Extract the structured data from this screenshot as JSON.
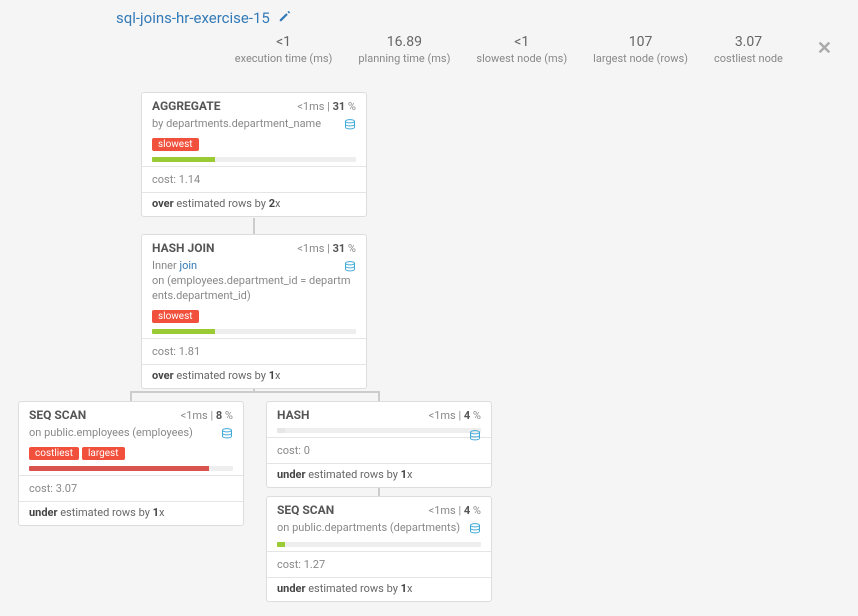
{
  "title": "sql-joins-hr-exercise-15",
  "stats": {
    "exec_val": "<1",
    "exec_lbl": "execution time (ms)",
    "plan_val": "16.89",
    "plan_lbl": "planning time (ms)",
    "slow_val": "<1",
    "slow_lbl": "slowest node (ms)",
    "large_val": "107",
    "large_lbl": "largest node (rows)",
    "cost_val": "3.07",
    "cost_lbl": "costliest node"
  },
  "nodes": {
    "agg": {
      "type": "AGGREGATE",
      "time": "<1ms",
      "pct": "31",
      "desc_pre": "by ",
      "desc": "departments.department_name",
      "tags": [
        "slowest"
      ],
      "bar_w": "31%",
      "bar_color": "#9acb34",
      "cost_lbl": "cost: ",
      "cost": "1.14",
      "est_pre": "over",
      "est_mid": " estimated rows by ",
      "est_x": "2",
      "est_suf": "x"
    },
    "hash_join": {
      "type": "HASH JOIN",
      "time": "<1ms",
      "pct": "31",
      "desc_pre": "Inner ",
      "desc_link": "join",
      "desc2_pre": "on ",
      "desc2": "(employees.department_id = departments.department_id)",
      "tags": [
        "slowest"
      ],
      "bar_w": "31%",
      "bar_color": "#9acb34",
      "cost_lbl": "cost: ",
      "cost": "1.81",
      "est_pre": "over",
      "est_mid": " estimated rows by ",
      "est_x": "1",
      "est_suf": "x"
    },
    "seq_emp": {
      "type": "SEQ SCAN",
      "time": "<1ms",
      "pct": "8",
      "desc_pre": "on ",
      "desc": "public.employees (employees)",
      "tags": [
        "costliest",
        "largest"
      ],
      "bar_w": "88%",
      "bar_color": "#d9534f",
      "cost_lbl": "cost: ",
      "cost": "3.07",
      "est_pre": "under",
      "est_mid": " estimated rows by ",
      "est_x": "1",
      "est_suf": "x"
    },
    "hash": {
      "type": "HASH",
      "time": "<1ms",
      "pct": "4",
      "bar_w": "4%",
      "bar_color": "#e6e6e6",
      "cost_lbl": "cost: ",
      "cost": "0",
      "est_pre": "under",
      "est_mid": " estimated rows by ",
      "est_x": "1",
      "est_suf": "x"
    },
    "seq_dep": {
      "type": "SEQ SCAN",
      "time": "<1ms",
      "pct": "4",
      "desc_pre": "on ",
      "desc": "public.departments (departments)",
      "bar_w": "4%",
      "bar_color": "#9acb34",
      "cost_lbl": "cost: ",
      "cost": "1.27",
      "est_pre": "under",
      "est_mid": " estimated rows by ",
      "est_x": "1",
      "est_suf": "x"
    }
  }
}
